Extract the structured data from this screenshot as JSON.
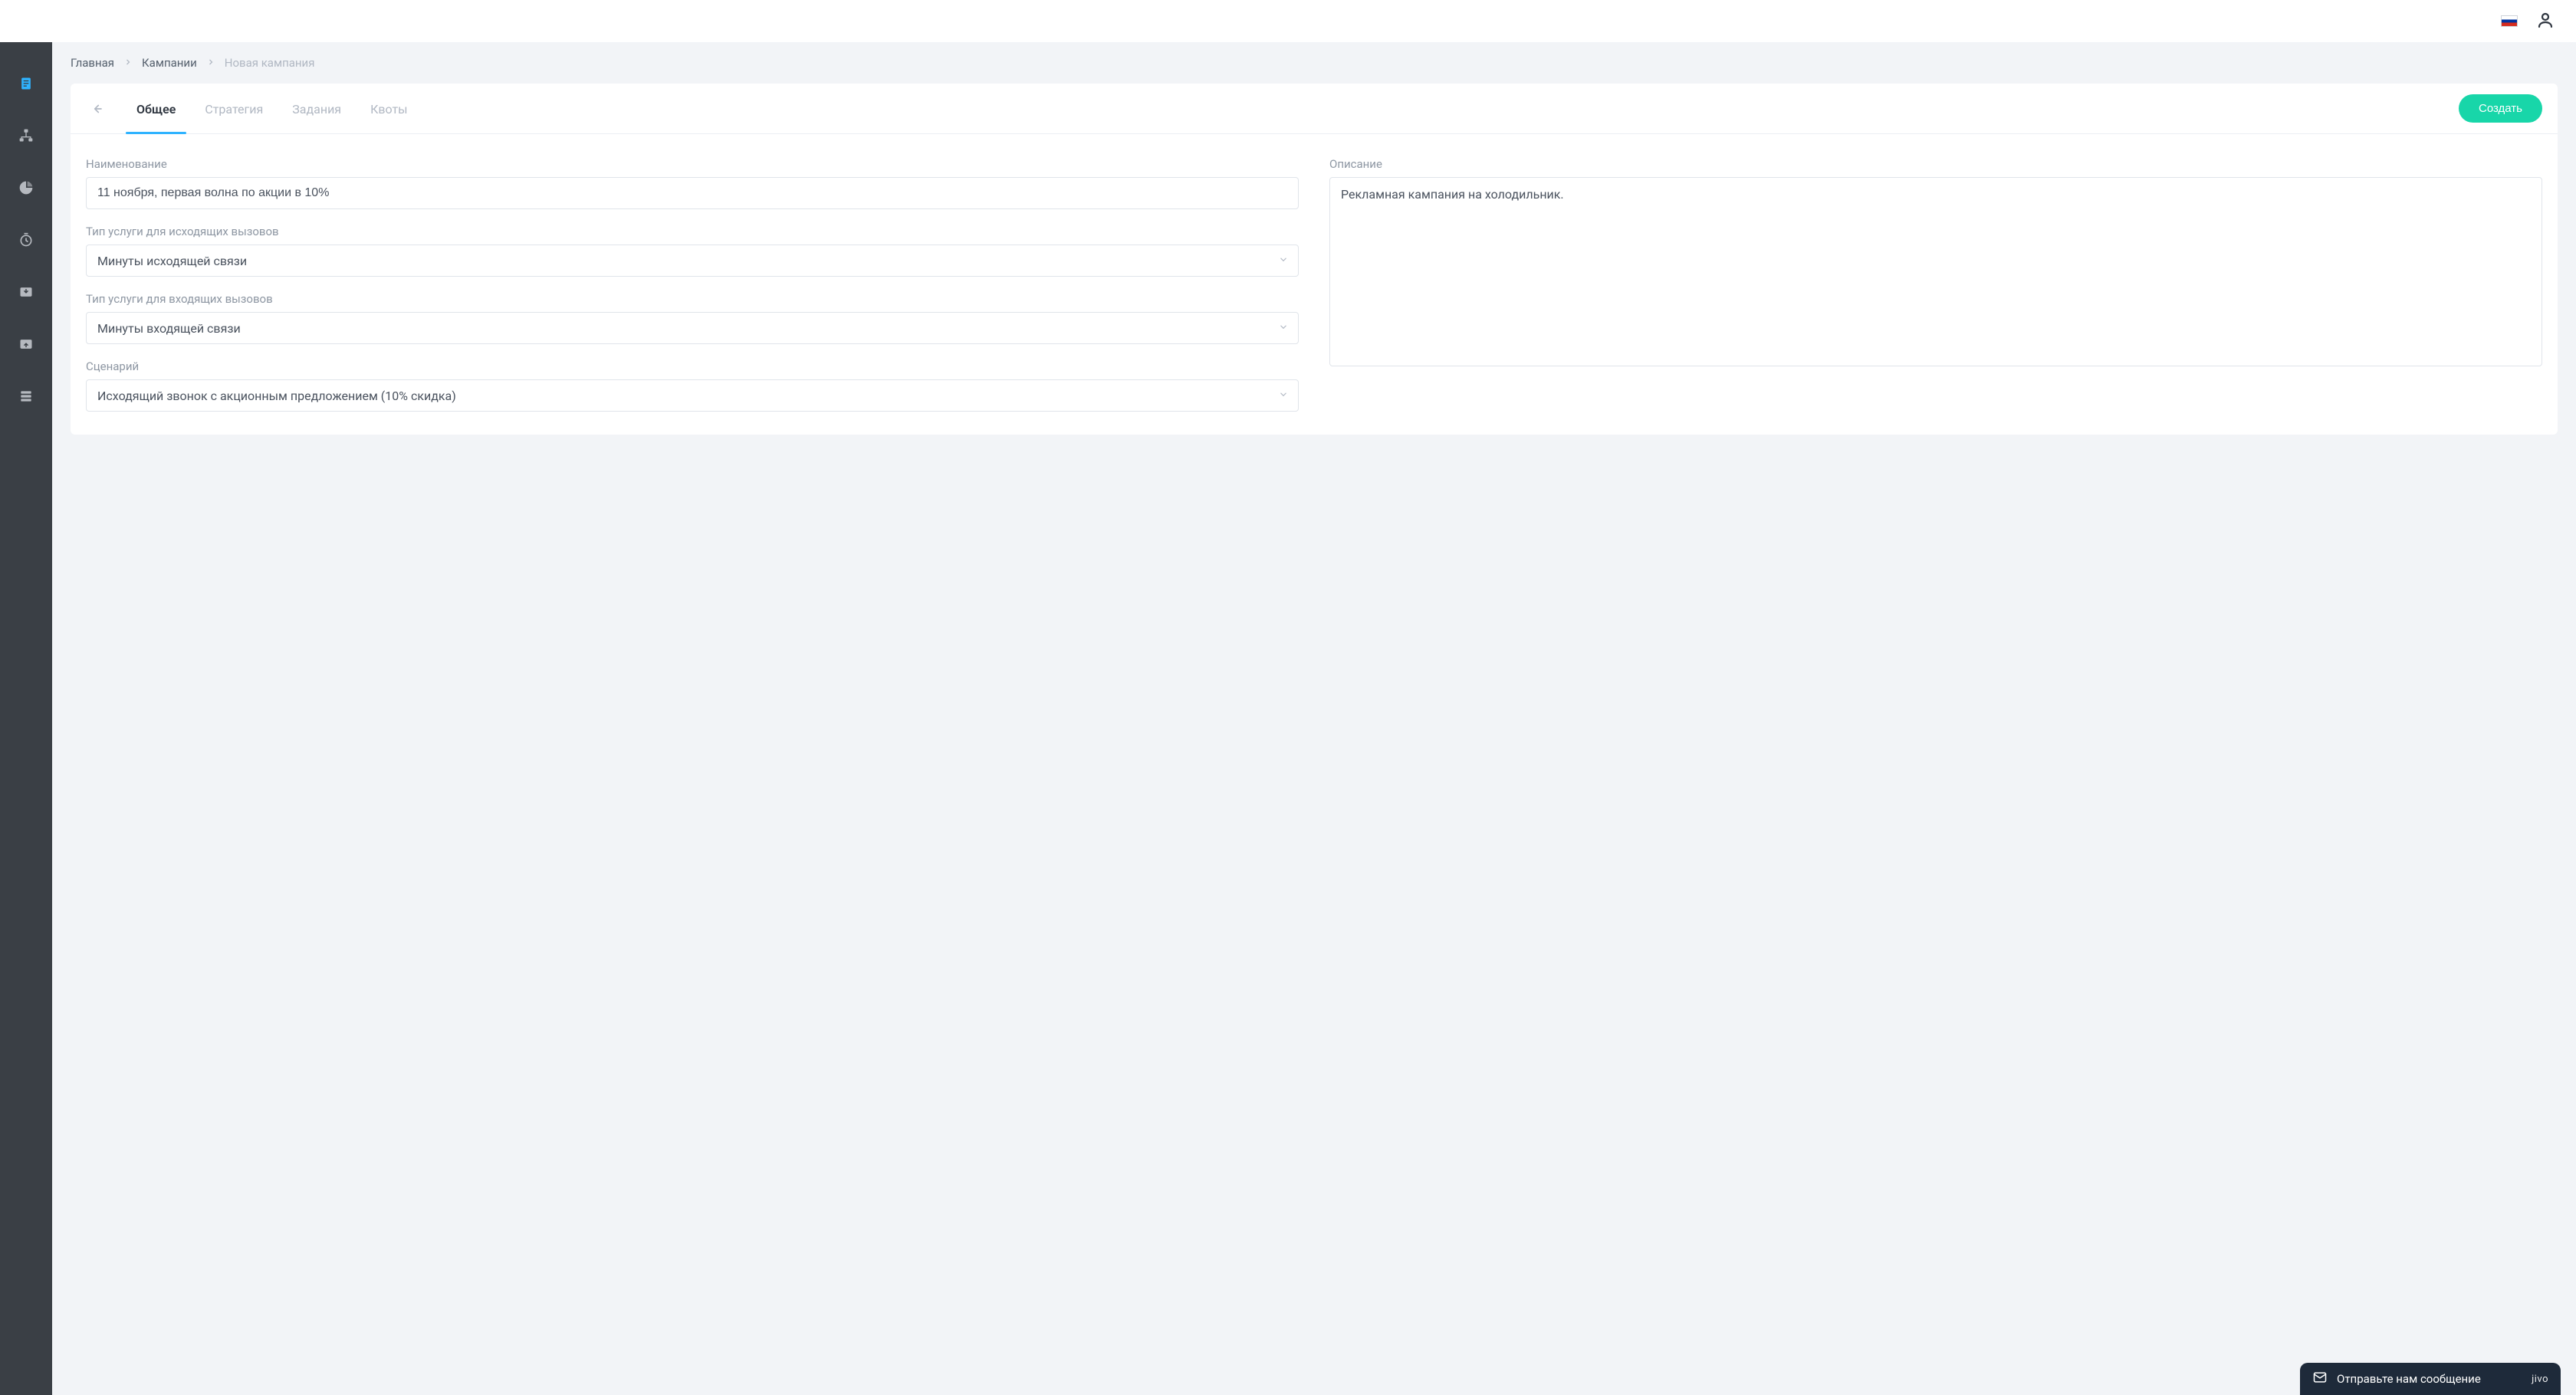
{
  "header": {
    "language_flag": "ru"
  },
  "sidebar": {
    "items": [
      {
        "icon": "document",
        "active": true
      },
      {
        "icon": "org-chart",
        "active": false
      },
      {
        "icon": "pie-chart",
        "active": false
      },
      {
        "icon": "timer",
        "active": false
      },
      {
        "icon": "inbox-down",
        "active": false
      },
      {
        "icon": "inbox-up",
        "active": false
      },
      {
        "icon": "server",
        "active": false
      }
    ]
  },
  "breadcrumbs": {
    "home": "Главная",
    "campaigns": "Кампании",
    "current": "Новая кампания"
  },
  "tabs": {
    "general": "Общее",
    "strategy": "Стратегия",
    "tasks": "Задания",
    "quotas": "Квоты"
  },
  "buttons": {
    "create": "Создать"
  },
  "form": {
    "name": {
      "label": "Наименование",
      "value": "11 ноября, первая волна по акции в 10%"
    },
    "outgoing_service": {
      "label": "Тип услуги для исходящих вызовов",
      "value": "Минуты исходящей связи"
    },
    "incoming_service": {
      "label": "Тип услуги для входящих вызовов",
      "value": "Минуты входящей связи"
    },
    "scenario": {
      "label": "Сценарий",
      "value": "Исходящий звонок с акционным предложением (10% скидка)"
    },
    "description": {
      "label": "Описание",
      "value": "Рекламная кампания на холодильник."
    }
  },
  "chat": {
    "prompt": "Отправьте нам сообщение",
    "brand": "jivo"
  }
}
